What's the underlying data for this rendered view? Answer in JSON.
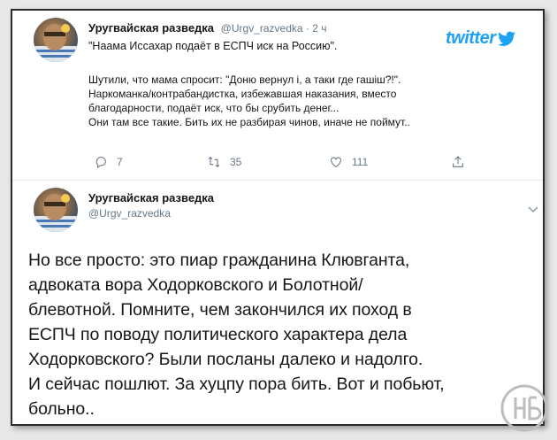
{
  "colors": {
    "brand": "#1da1f2",
    "text": "#14171a",
    "muted": "#657786"
  },
  "quoted_tweet": {
    "author_name": "Уругвайская разведка",
    "author_handle": "@Urgv_razvedka · 2 ч",
    "headline": "\"Наама Иссахар подаёт в ЕСПЧ иск на Россию\".",
    "lines": [
      "Шутили, что мама спросит: \"Доню вернул і, а таки где гашіш?!\".",
      "Наркоманка/контрабандистка, избежавшая наказания, вместо",
      "благодарности, подаёт иск, что бы срубить денег...",
      "Они там все такие. Бить их не разбирая чинов, иначе не поймут.."
    ],
    "reply_count": "7",
    "retweet_count": "35",
    "like_count": "111",
    "logo_text": "twitter",
    "logo_icon": "bird-icon"
  },
  "main_tweet": {
    "author_name": "Уругвайская разведка",
    "author_handle": "@Urgv_razvedka",
    "lines": [
      "Но все просто: это пиар гражданина Клювганта,",
      "адвоката вора Ходорковского и Болотной/",
      "блевотной. Помните, чем закончился их поход в",
      "ЕСПЧ по поводу политического характера дела",
      "Ходорковского? Были посланы далеко и надолго.",
      "И сейчас пошлют. За хуцпу пора бить. Вот и побьют,",
      "больно.."
    ],
    "menu_icon": "chevron-down-icon"
  }
}
